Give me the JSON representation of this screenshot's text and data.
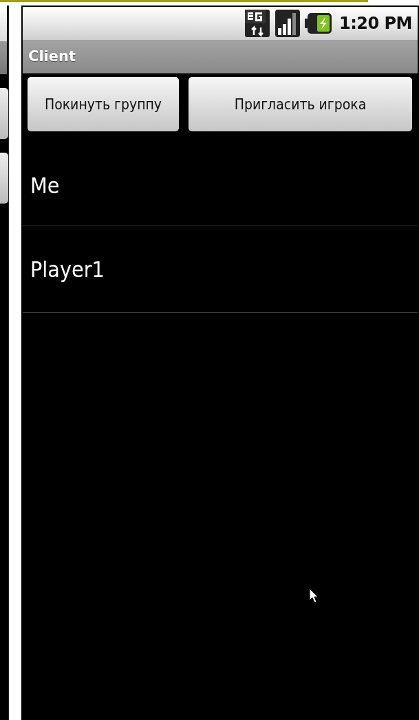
{
  "status_bar": {
    "time": "1:20 PM"
  },
  "title_bar": {
    "title": "Client"
  },
  "buttons": [
    {
      "label": "Покинуть группу"
    },
    {
      "label": "Пригласить игрока"
    }
  ],
  "players": [
    {
      "name": "Me"
    },
    {
      "name": "Player1"
    }
  ]
}
